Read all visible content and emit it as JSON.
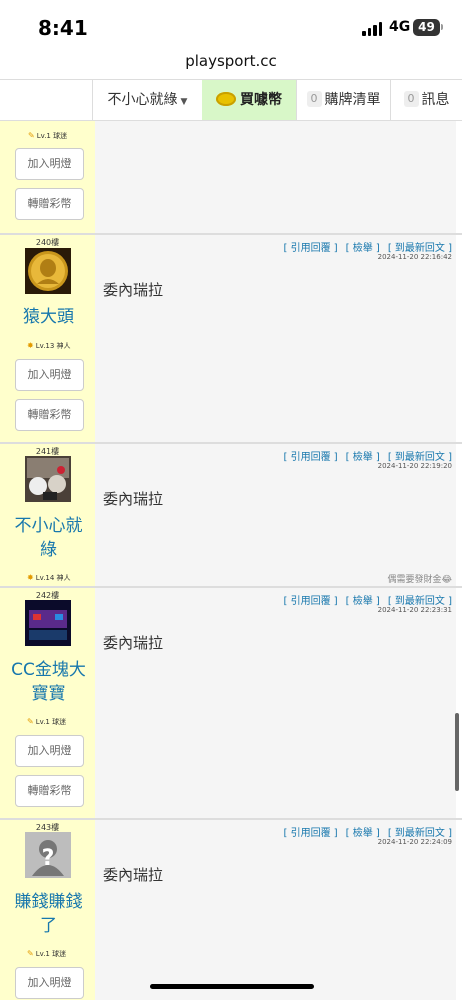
{
  "status": {
    "time": "8:41",
    "network": "4G",
    "battery": "49"
  },
  "browser": {
    "url": "playsport.cc"
  },
  "nav": {
    "user": "不小心就綠",
    "buy": "買噱幣",
    "cart_count": "0",
    "cart": "購牌清單",
    "msg_count": "0",
    "msg": "訊息"
  },
  "buttons": {
    "add_light": "加入明燈",
    "gift": "轉贈彩幣"
  },
  "post_links": {
    "quote": "[ 引用回覆 ]",
    "report": "[ 檢舉 ]",
    "latest": "[ 到最新回文 ]"
  },
  "prev_post": {
    "level": "Lv.1 球迷"
  },
  "posts": [
    {
      "floor": "240樓",
      "user": "猿大頭",
      "level": "Lv.13 神人",
      "time": "2024-11-20 22:16:42",
      "content": "委內瑞拉"
    },
    {
      "floor": "241樓",
      "user_line1": "不小心就",
      "user_line2": "綠",
      "level": "Lv.14 神人",
      "time": "2024-11-20 22:19:20",
      "content": "委內瑞拉",
      "signature": "偶需要發財金😂"
    },
    {
      "floor": "242樓",
      "user_line1": "CC金塊大",
      "user_line2": "寶寶",
      "level": "Lv.1 球迷",
      "time": "2024-11-20 22:23:31",
      "content": "委內瑞拉"
    },
    {
      "floor": "243樓",
      "user_line1": "賺錢賺錢",
      "user_line2": "了",
      "level": "Lv.1 球迷",
      "time": "2024-11-20 22:24:09",
      "content": "委內瑞拉"
    }
  ]
}
